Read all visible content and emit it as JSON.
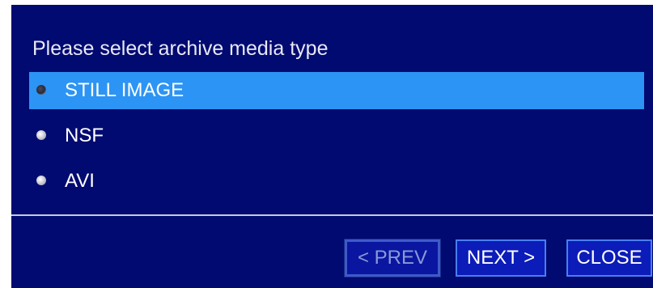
{
  "dialog": {
    "prompt": "Please select archive media type",
    "options": [
      {
        "label": "STILL IMAGE",
        "selected": true
      },
      {
        "label": "NSF",
        "selected": false
      },
      {
        "label": "AVI",
        "selected": false
      }
    ],
    "buttons": {
      "prev_label": "< PREV",
      "next_label": "NEXT >",
      "close_label": "CLOSE"
    }
  },
  "colors": {
    "background": "#000a70",
    "selection": "#2c94f4",
    "button": "#0c1cb8",
    "button_border": "#4a7ef0"
  }
}
